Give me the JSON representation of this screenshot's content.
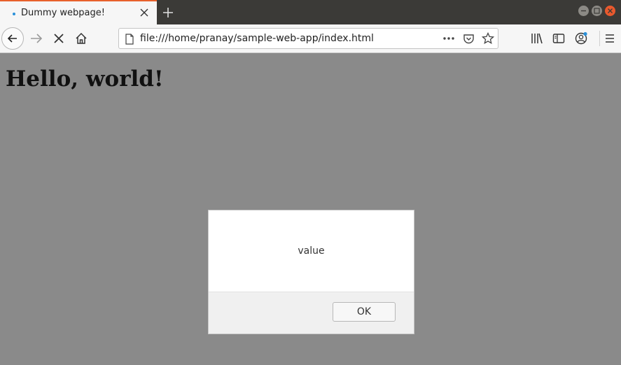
{
  "tab": {
    "title": "Dummy webpage!"
  },
  "navbar": {
    "url": "file:///home/pranay/sample-web-app/index.html"
  },
  "page": {
    "heading": "Hello, world!"
  },
  "dialog": {
    "message": "value",
    "ok_label": "OK"
  },
  "colors": {
    "accent": "#e8612c",
    "tab_dot": "#2a90d9",
    "close_window": "#e9592d",
    "backdrop": "#8a8a8a"
  },
  "icons": [
    "close-icon",
    "plus-icon",
    "back-arrow-icon",
    "forward-arrow-icon",
    "stop-icon",
    "home-icon",
    "page-icon",
    "more-icon",
    "pocket-icon",
    "star-icon",
    "library-icon",
    "sidebar-icon",
    "account-icon",
    "menu-icon"
  ]
}
